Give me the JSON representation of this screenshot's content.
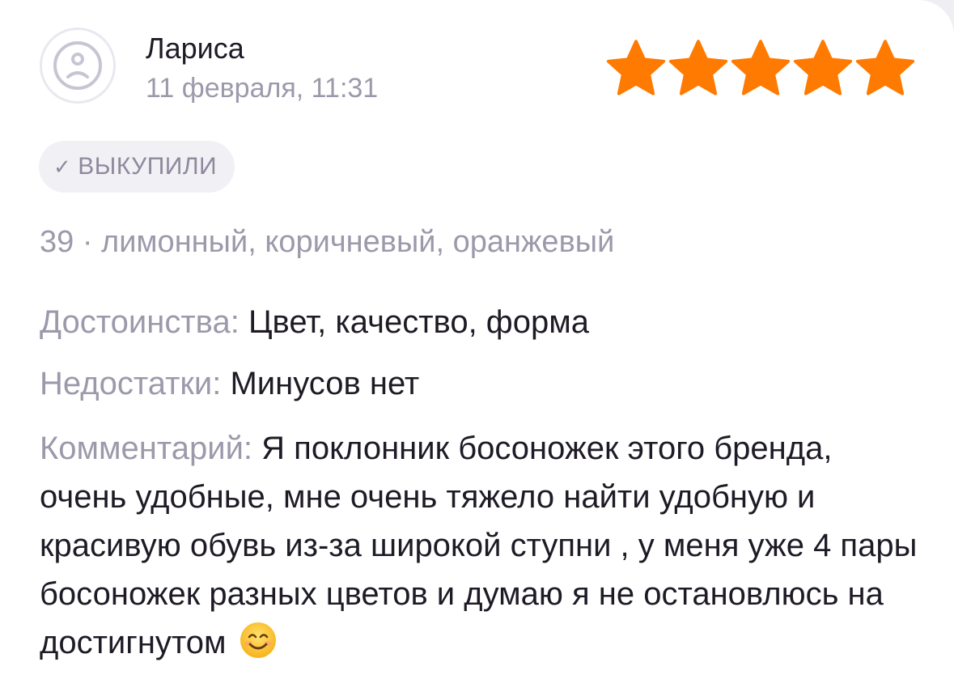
{
  "review": {
    "author": "Лариса",
    "date": "11 февраля, 11:31",
    "avatar_icon": "sad-face-icon",
    "rating": 5,
    "rating_max": 5,
    "star_color": "#ff7a00",
    "badge": {
      "icon": "check-icon",
      "label": "ВЫКУПИЛИ"
    },
    "variant": "39 · лимонный, коричневый, оранжевый",
    "pros": {
      "label": "Достоинства:",
      "text": "Цвет, качество, форма"
    },
    "cons": {
      "label": "Недостатки:",
      "text": "Минусов нет"
    },
    "comment": {
      "label": "Комментарий:",
      "text": "Я поклонник босоножек этого бренда, очень удобные, мне очень тяжело найти удобную и красивую обувь из-за широкой ступни , у меня уже 4 пары босоножек разных цветов и думаю я не остановлюсь на достигнутом",
      "emoji": "smiling-face-emoji"
    }
  }
}
